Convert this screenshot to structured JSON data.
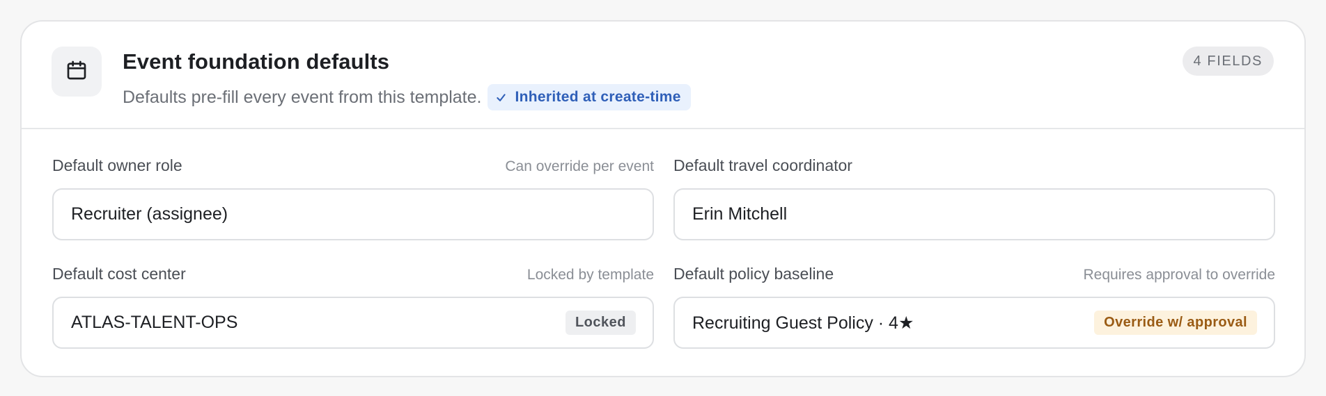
{
  "card": {
    "icon": "calendar-icon",
    "title": "Event foundation defaults",
    "subtitle": "Defaults pre-fill every event from this template.",
    "inherited_badge": "Inherited at create-time",
    "field_count": "4 FIELDS"
  },
  "fields": {
    "owner_role": {
      "label": "Default owner role",
      "hint": "Can override per event",
      "value": "Recruiter (assignee)"
    },
    "travel_coordinator": {
      "label": "Default travel coordinator",
      "value": "Erin Mitchell"
    },
    "cost_center": {
      "label": "Default cost center",
      "hint": "Locked by template",
      "value": "ATLAS-TALENT-OPS",
      "badge": "Locked"
    },
    "policy_baseline": {
      "label": "Default policy baseline",
      "hint": "Requires approval to override",
      "value": "Recruiting Guest Policy · 4★",
      "badge": "Override w/ approval"
    }
  },
  "colors": {
    "accent_blue": "#2f5fb8",
    "accent_blue_bg": "#e9f1fd",
    "warning_text": "#9a5b14",
    "warning_bg": "#fdf2de"
  }
}
